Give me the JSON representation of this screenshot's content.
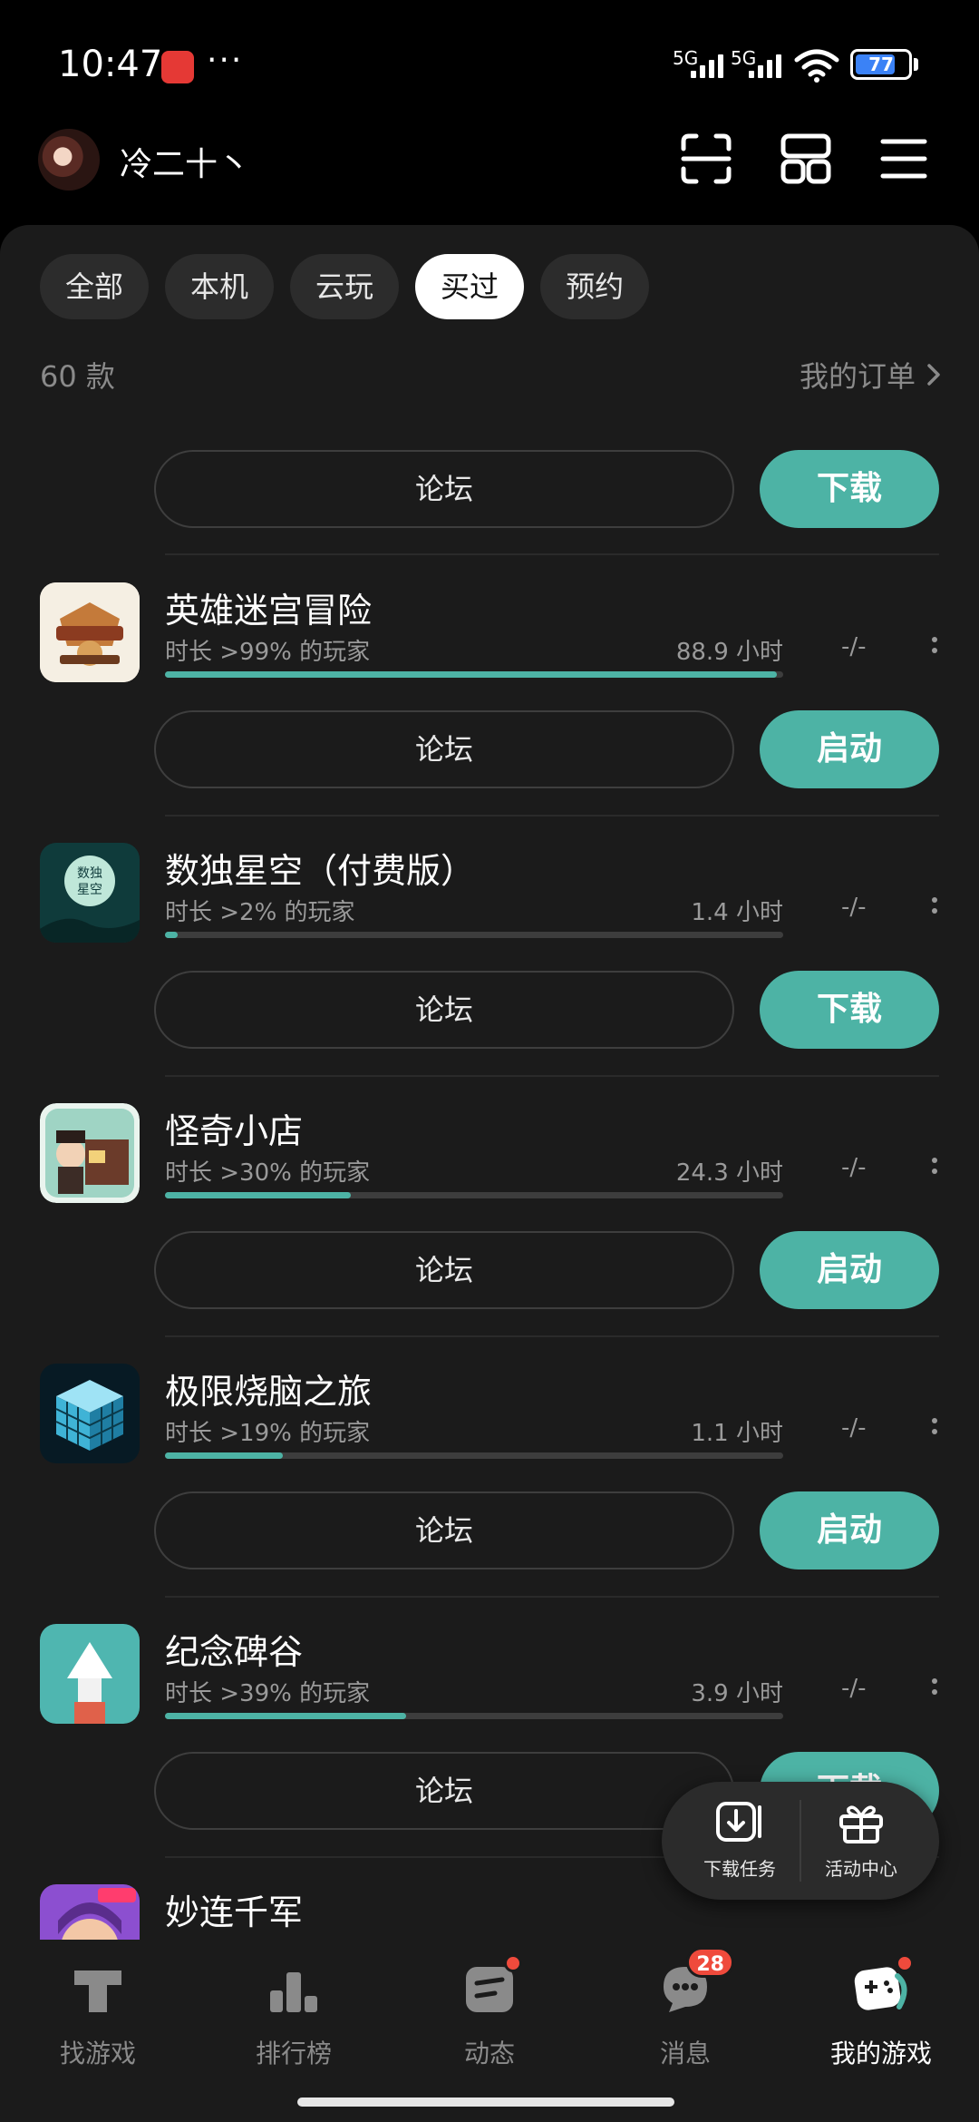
{
  "status_bar": {
    "time": "10:47",
    "more": "···",
    "signal1_label": "5G",
    "signal2_label": "5G",
    "battery_level": "77",
    "battery_fraction": 0.77
  },
  "header": {
    "username": "冷二十丶",
    "icons": [
      "scan-icon",
      "grid-icon",
      "menu-icon"
    ]
  },
  "filters": {
    "chips": [
      "全部",
      "本机",
      "云玩",
      "买过",
      "预约"
    ],
    "selected": "买过"
  },
  "summary": {
    "count": "60 款",
    "orders_link": "我的订单"
  },
  "first_row": {
    "forum_label": "论坛",
    "action_label": "下载"
  },
  "games": [
    {
      "title": "英雄迷宫冒险",
      "rank": "时长 >99% 的玩家",
      "hours": "88.9 小时",
      "score": "-/-",
      "progress": 0.99,
      "forum_label": "论坛",
      "action_label": "启动",
      "icon": "hero-maze-icon"
    },
    {
      "title": "数独星空（付费版）",
      "rank": "时长 >2% 的玩家",
      "hours": "1.4 小时",
      "score": "-/-",
      "progress": 0.02,
      "forum_label": "论坛",
      "action_label": "下载",
      "icon": "sudoku-starry-icon"
    },
    {
      "title": "怪奇小店",
      "rank": "时长 >30% 的玩家",
      "hours": "24.3 小时",
      "score": "-/-",
      "progress": 0.3,
      "forum_label": "论坛",
      "action_label": "启动",
      "icon": "strange-shop-icon"
    },
    {
      "title": "极限烧脑之旅",
      "rank": "时长 >19% 的玩家",
      "hours": "1.1 小时",
      "score": "-/-",
      "progress": 0.19,
      "forum_label": "论坛",
      "action_label": "启动",
      "icon": "cube-puzzle-icon"
    },
    {
      "title": "纪念碑谷",
      "rank": "时长 >39% 的玩家",
      "hours": "3.9 小时",
      "score": "-/-",
      "progress": 0.39,
      "forum_label": "论坛",
      "action_label": "下载",
      "icon": "monument-valley-icon"
    },
    {
      "title": "妙连千军",
      "icon": "miaolian-icon"
    }
  ],
  "floating": {
    "download_tasks": "下载任务",
    "activity_center": "活动中心"
  },
  "bottom_nav": {
    "items": [
      {
        "label": "找游戏",
        "icon": "find-games-icon"
      },
      {
        "label": "排行榜",
        "icon": "leaderboard-icon"
      },
      {
        "label": "动态",
        "icon": "feed-icon"
      },
      {
        "label": "消息",
        "icon": "messages-icon",
        "badge": "28"
      },
      {
        "label": "我的游戏",
        "icon": "my-games-icon"
      }
    ],
    "active": "我的游戏"
  },
  "colors": {
    "accent": "#4db3a5",
    "background": "#1b1b1b",
    "badge": "#ef4a3c"
  }
}
